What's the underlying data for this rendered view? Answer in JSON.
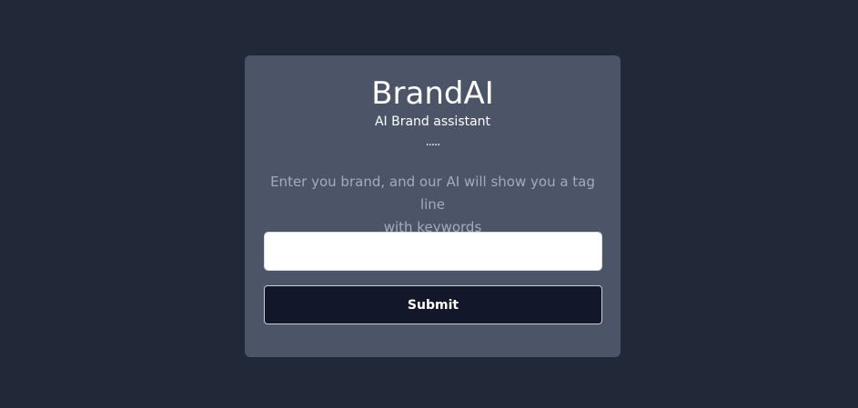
{
  "card": {
    "title": "BrandAI",
    "subtitle": "AI Brand assistant",
    "dots": ".....",
    "description_text": "Enter you brand, and our AI will show you a tag line",
    "description_link": "with keywords"
  },
  "form": {
    "brand_input_value": "",
    "brand_input_placeholder": "",
    "submit_label": "Submit"
  },
  "colors": {
    "page_background": "#212838",
    "card_background": "#4b5567",
    "button_background": "#121829",
    "muted_text": "#a3acbb"
  }
}
